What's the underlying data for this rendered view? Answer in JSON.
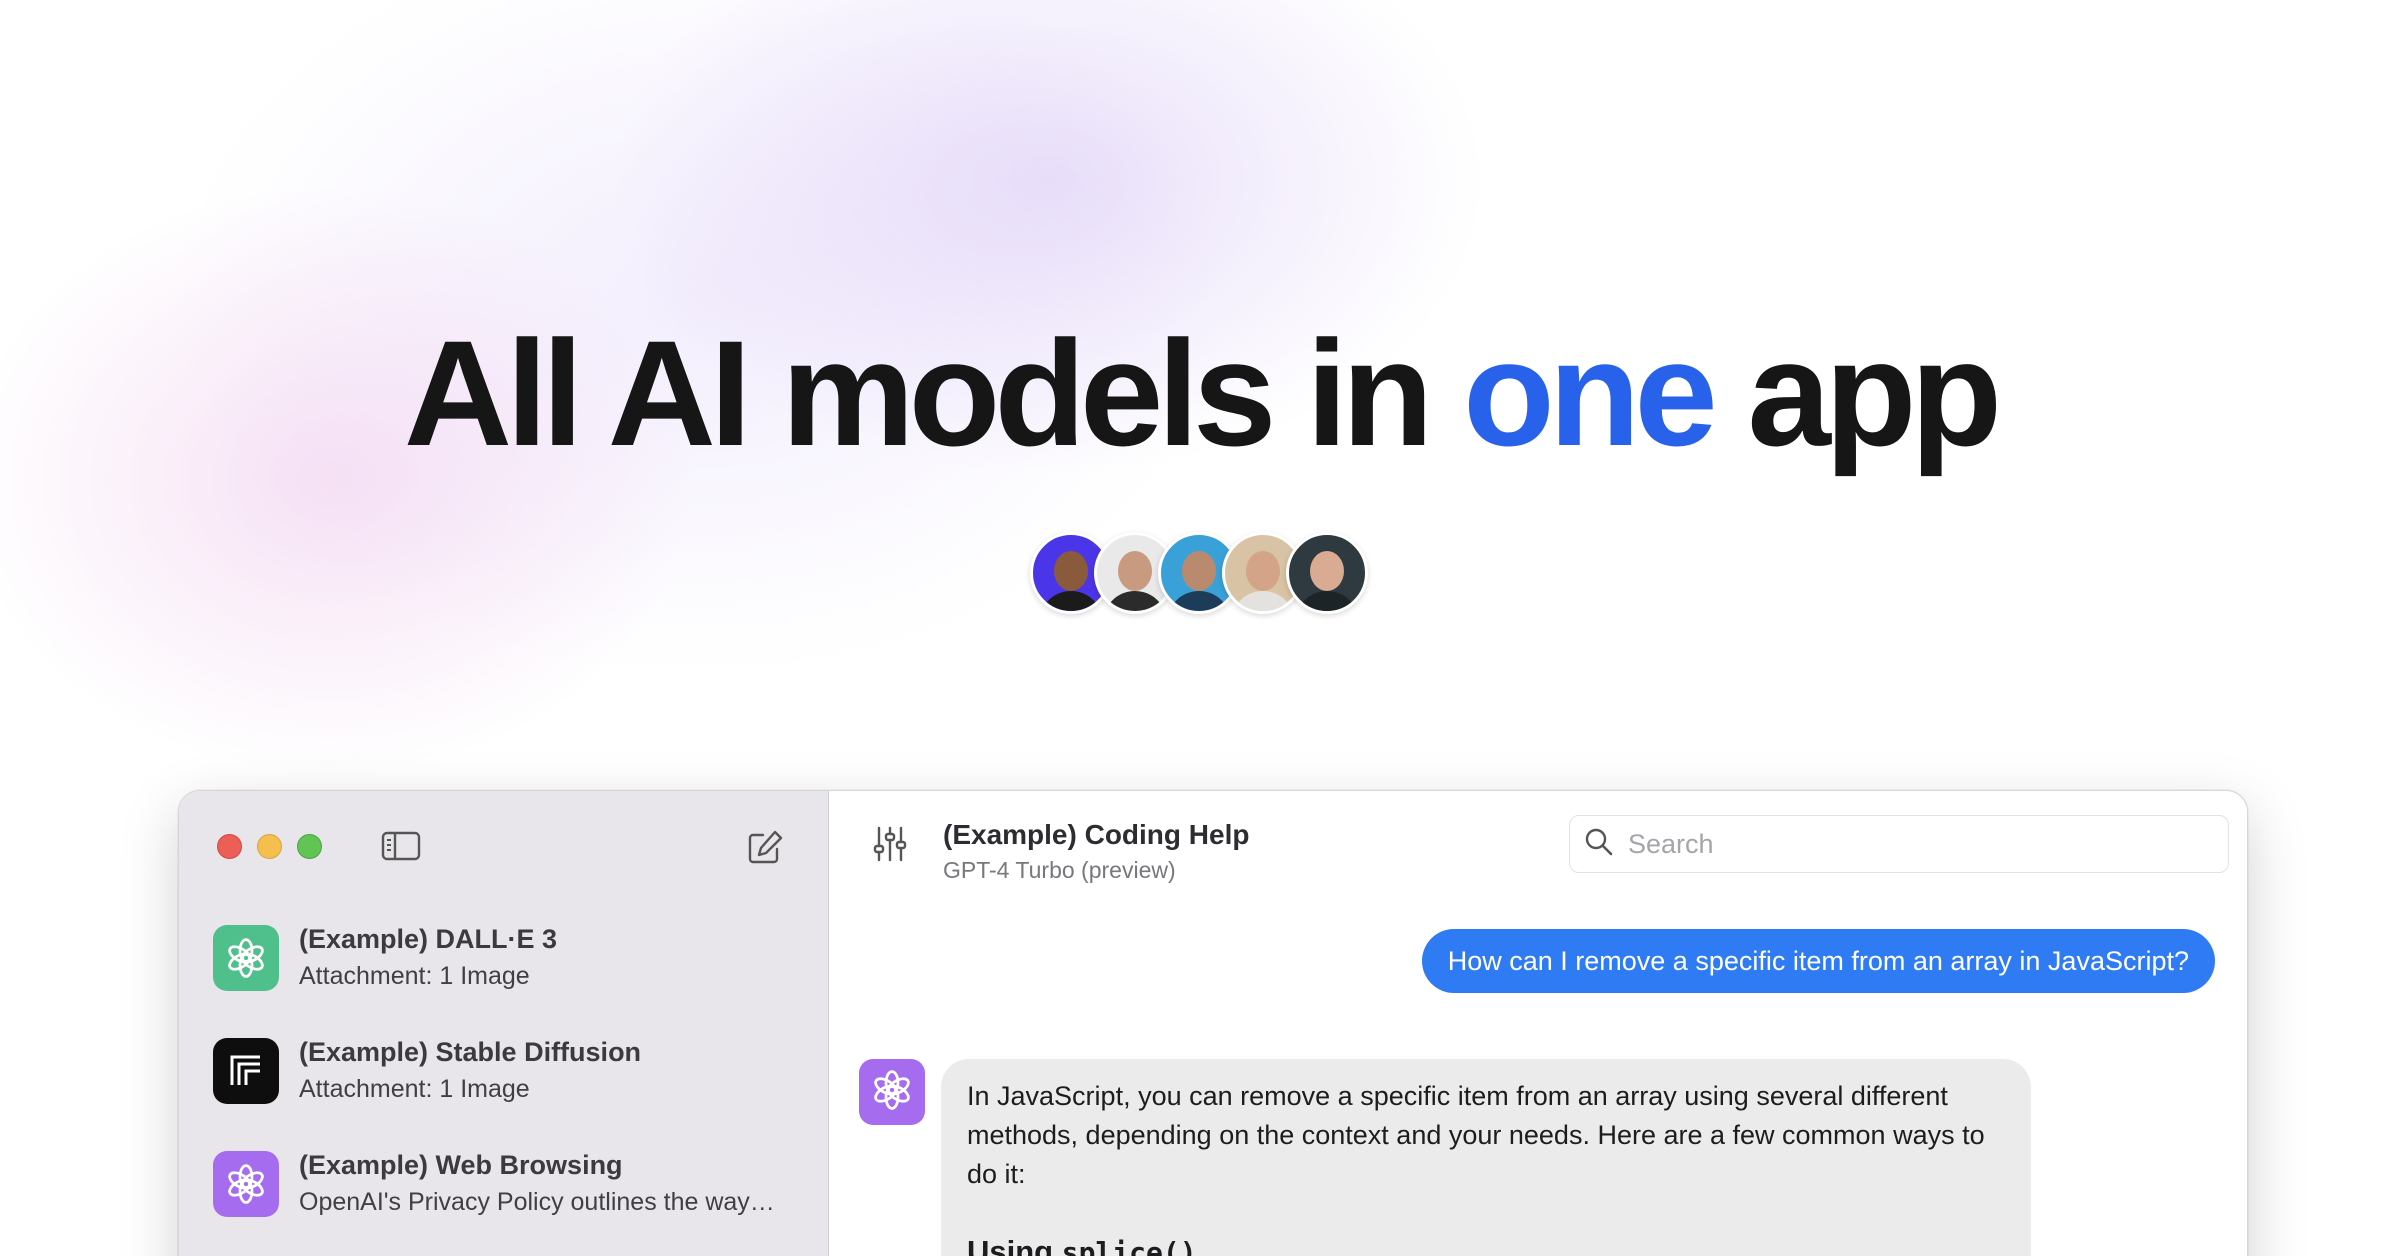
{
  "hero": {
    "title_part1": "All AI models in ",
    "title_accent": "one",
    "title_part2": " app",
    "accent_color": "#2962ea"
  },
  "avatars": [
    {
      "name": "avatar-1",
      "bg": "#4b35e8",
      "skin": "#8a5a3c",
      "shirt": "#1b1b1b"
    },
    {
      "name": "avatar-2",
      "bg": "#e9e9ea",
      "skin": "#c89a80",
      "shirt": "#2b2b2b"
    },
    {
      "name": "avatar-3",
      "bg": "#3aa1d8",
      "skin": "#b98a6d",
      "shirt": "#1c3c5a"
    },
    {
      "name": "avatar-4",
      "bg": "#d8c3a4",
      "skin": "#d4a488",
      "shirt": "#e4e2de"
    },
    {
      "name": "avatar-5",
      "bg": "#2e3a3f",
      "skin": "#d8ab92",
      "shirt": "#1d2428"
    }
  ],
  "sidebar": {
    "conversations": [
      {
        "title": "(Example) DALL·E 3",
        "subtitle": "Attachment: 1 Image",
        "icon": "openai-icon",
        "icon_color": "#4fbf8b"
      },
      {
        "title": "(Example) Stable Diffusion",
        "subtitle": "Attachment: 1 Image",
        "icon": "stability-icon",
        "icon_color": "#0e0e0e"
      },
      {
        "title": "(Example) Web Browsing",
        "subtitle": "OpenAI's Privacy Policy outlines the way…",
        "icon": "openai-icon",
        "icon_color": "#a56cf0"
      }
    ]
  },
  "chat": {
    "title": "(Example) Coding Help",
    "model": "GPT-4 Turbo (preview)",
    "search_placeholder": "Search",
    "user_message": "How can I remove a specific item from an array in JavaScript?",
    "assistant_message": "In JavaScript, you can remove a specific item from an array using several different methods, depending on the context and your needs. Here are a few common ways to do it:",
    "assistant_heading_prefix": "Using ",
    "assistant_heading_code": "splice()"
  }
}
